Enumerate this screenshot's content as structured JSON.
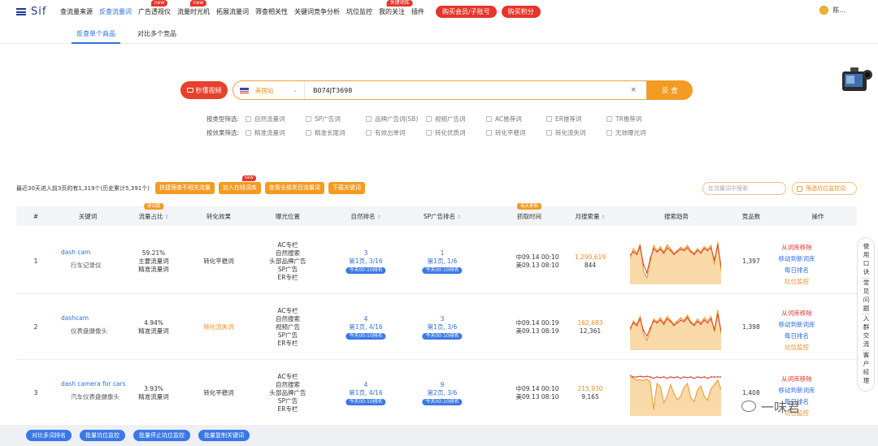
{
  "nav": {
    "logo": "Sif",
    "items": [
      {
        "label": "查流量来源",
        "tag": ""
      },
      {
        "label": "反查流量词",
        "tag": "",
        "active": true
      },
      {
        "label": "广告透视仪",
        "tag": "new"
      },
      {
        "label": "流量时光机",
        "tag": "new"
      },
      {
        "label": "拓展流量词",
        "tag": ""
      },
      {
        "label": "筛查相关性",
        "tag": ""
      },
      {
        "label": "关键词竞争分析",
        "tag": ""
      },
      {
        "label": "坑位监控",
        "tag": ""
      },
      {
        "label": "我的关注",
        "tag": "关键词库"
      },
      {
        "label": "插件",
        "tag": ""
      }
    ],
    "buy_member": "购买会员/子账号",
    "buy_points": "购买积分",
    "user": "陈..."
  },
  "subtabs": [
    "反查单个商品",
    "对比多个竞品"
  ],
  "search": {
    "video_btn": "秒懂视频",
    "site": "美国站",
    "asin": "B074JT3698",
    "clear": "×",
    "go": "反 查"
  },
  "filters": {
    "type_label": "按类型筛选:",
    "type_options": [
      "自然流量词",
      "SP广告词",
      "品牌广告词(SB)",
      "视频广告词",
      "AC推荐词",
      "ER推荐词",
      "TR推荐词"
    ],
    "effect_label": "按效果筛选:",
    "effect_options": [
      "精准流量词",
      "精准长尾词",
      "有效出单词",
      "转化优质词",
      "转化平稳词",
      "转化流失词",
      "无效曝光词"
    ]
  },
  "stat": "最近30天进入前3页的有1,319个(历史累计5,391个)",
  "actions": [
    "快捷筛查不相关流量",
    "加入在线词库",
    "查看全部类目流量词",
    "下载关键词"
  ],
  "actions_tag": "new",
  "filter_search_placeholder": "在流量词中搜索",
  "filter_check": "筛选坑位监控词",
  "table": {
    "headers": [
      "#",
      "关键词",
      "流量占比",
      "转化效果",
      "曝光位置",
      "自然排名",
      "SP广告排名",
      "抓取时间",
      "月搜索量",
      "搜索趋势",
      "竞品数",
      "操作"
    ],
    "tag_ratio": "测试版",
    "tag_time": "每天更新",
    "rows": [
      {
        "idx": "1",
        "kw_en": "dash cam",
        "kw_cn": "行车记录仪",
        "ratio": "59.21%",
        "ratio_l1": "主要流量词",
        "ratio_l2": "精准流量词",
        "effect": "转化平稳词",
        "effect_color": "#333333",
        "exposure": [
          "AC专栏",
          "自然搜索",
          "头部品牌广告",
          "SP广告",
          "ER专栏"
        ],
        "nat_rank": "3",
        "nat_page": "第1页, 3/16",
        "nat_pill": "今天00:10排名",
        "sp_rank": "1",
        "sp_page": "第1页, 1/6",
        "sp_pill": "今天00:10排名",
        "time1": "中09.14 00:10",
        "time2": "美09.13 08:10",
        "vol": "1,290,619",
        "vol2": "844",
        "trend_a": [
          40,
          55,
          48,
          62,
          20,
          10,
          35,
          60,
          52,
          58,
          50,
          61,
          55,
          48,
          52,
          57,
          54,
          60,
          52,
          48,
          55,
          50,
          58,
          54,
          60,
          30,
          65,
          20
        ],
        "trend_b": [
          45,
          50,
          46,
          58,
          30,
          18,
          40,
          55,
          50,
          54,
          48,
          56,
          52,
          46,
          50,
          54,
          52,
          56,
          50,
          46,
          52,
          48,
          55,
          52,
          56,
          38,
          60,
          28
        ],
        "competitors": "1,397",
        "ops": [
          "从词库移除",
          "移动到新词库",
          "每日排名",
          "坑位监控"
        ]
      },
      {
        "idx": "2",
        "kw_en": "dashcam",
        "kw_cn": "仪表盘摄像头",
        "ratio": "4.94%",
        "ratio_l1": "精准流量词",
        "ratio_l2": "",
        "effect": "转化流失词",
        "effect_color": "#f08c1c",
        "exposure": [
          "AC专栏",
          "自然搜索",
          "视频广告",
          "SP广告",
          "ER专栏"
        ],
        "nat_rank": "4",
        "nat_page": "第1页, 4/16",
        "nat_pill": "今天00:10排名",
        "sp_rank": "3",
        "sp_page": "第1页, 3/6",
        "sp_pill": "今天00:10排名",
        "time1": "中09.14 00:19",
        "time2": "美09.13 08:19",
        "vol": "162,683",
        "vol2": "12,361",
        "trend_a": [
          30,
          45,
          40,
          52,
          25,
          15,
          30,
          48,
          44,
          50,
          42,
          52,
          46,
          40,
          45,
          50,
          46,
          54,
          44,
          40,
          48,
          42,
          50,
          45,
          52,
          28,
          62,
          25
        ],
        "trend_b": [
          34,
          42,
          38,
          48,
          30,
          22,
          34,
          45,
          42,
          46,
          40,
          48,
          44,
          38,
          42,
          46,
          44,
          50,
          42,
          38,
          44,
          40,
          46,
          42,
          48,
          32,
          55,
          30
        ],
        "competitors": "1,398",
        "ops": [
          "从词库移除",
          "移动到新词库",
          "每日排名",
          "坑位监控"
        ]
      },
      {
        "idx": "3",
        "kw_en": "dash camera for cars",
        "kw_cn": "汽车仪表盘摄像头",
        "ratio": "3.93%",
        "ratio_l1": "精准流量词",
        "ratio_l2": "",
        "effect": "转化平稳词",
        "effect_color": "#333333",
        "exposure": [
          "AC专栏",
          "自然搜索",
          "头部品牌广告",
          "SP广告",
          "ER专栏"
        ],
        "nat_rank": "4",
        "nat_page": "第1页, 4/16",
        "nat_pill": "今天00:10排名",
        "sp_rank": "9",
        "sp_page": "第2页, 3/6",
        "sp_pill": "今天00:10排名",
        "time1": "中09.14 00:10",
        "time2": "美09.13 08:10",
        "vol": "215,930",
        "vol2": "9,165",
        "trend_a": [
          60,
          58,
          55,
          56,
          54,
          57,
          52,
          10,
          50,
          45,
          20,
          30,
          48,
          35,
          25,
          30,
          44,
          50,
          28,
          22,
          40,
          46,
          30,
          24,
          42,
          48,
          55,
          40
        ],
        "trend_b": [
          62,
          60,
          60,
          61,
          60,
          61,
          60,
          58,
          60,
          59,
          60,
          58,
          60,
          59,
          60,
          58,
          60,
          59,
          60,
          58,
          60,
          59,
          60,
          58,
          60,
          60,
          60,
          60
        ],
        "competitors": "1,408",
        "ops": [
          "从词库移除",
          "移动到新词库",
          "每日排名",
          "坑位监控"
        ]
      }
    ]
  },
  "bottom": [
    "对比多词排名",
    "批量坑位监控",
    "批量停止坑位监控",
    "批量复制关键词"
  ],
  "side_help": [
    "使用口诀",
    "常见问题",
    "入群交流",
    "客户经理"
  ],
  "watermark": "一味君",
  "colors": {
    "accent": "#f39b22",
    "blue": "#2d6fe0",
    "red": "#e6352b"
  }
}
